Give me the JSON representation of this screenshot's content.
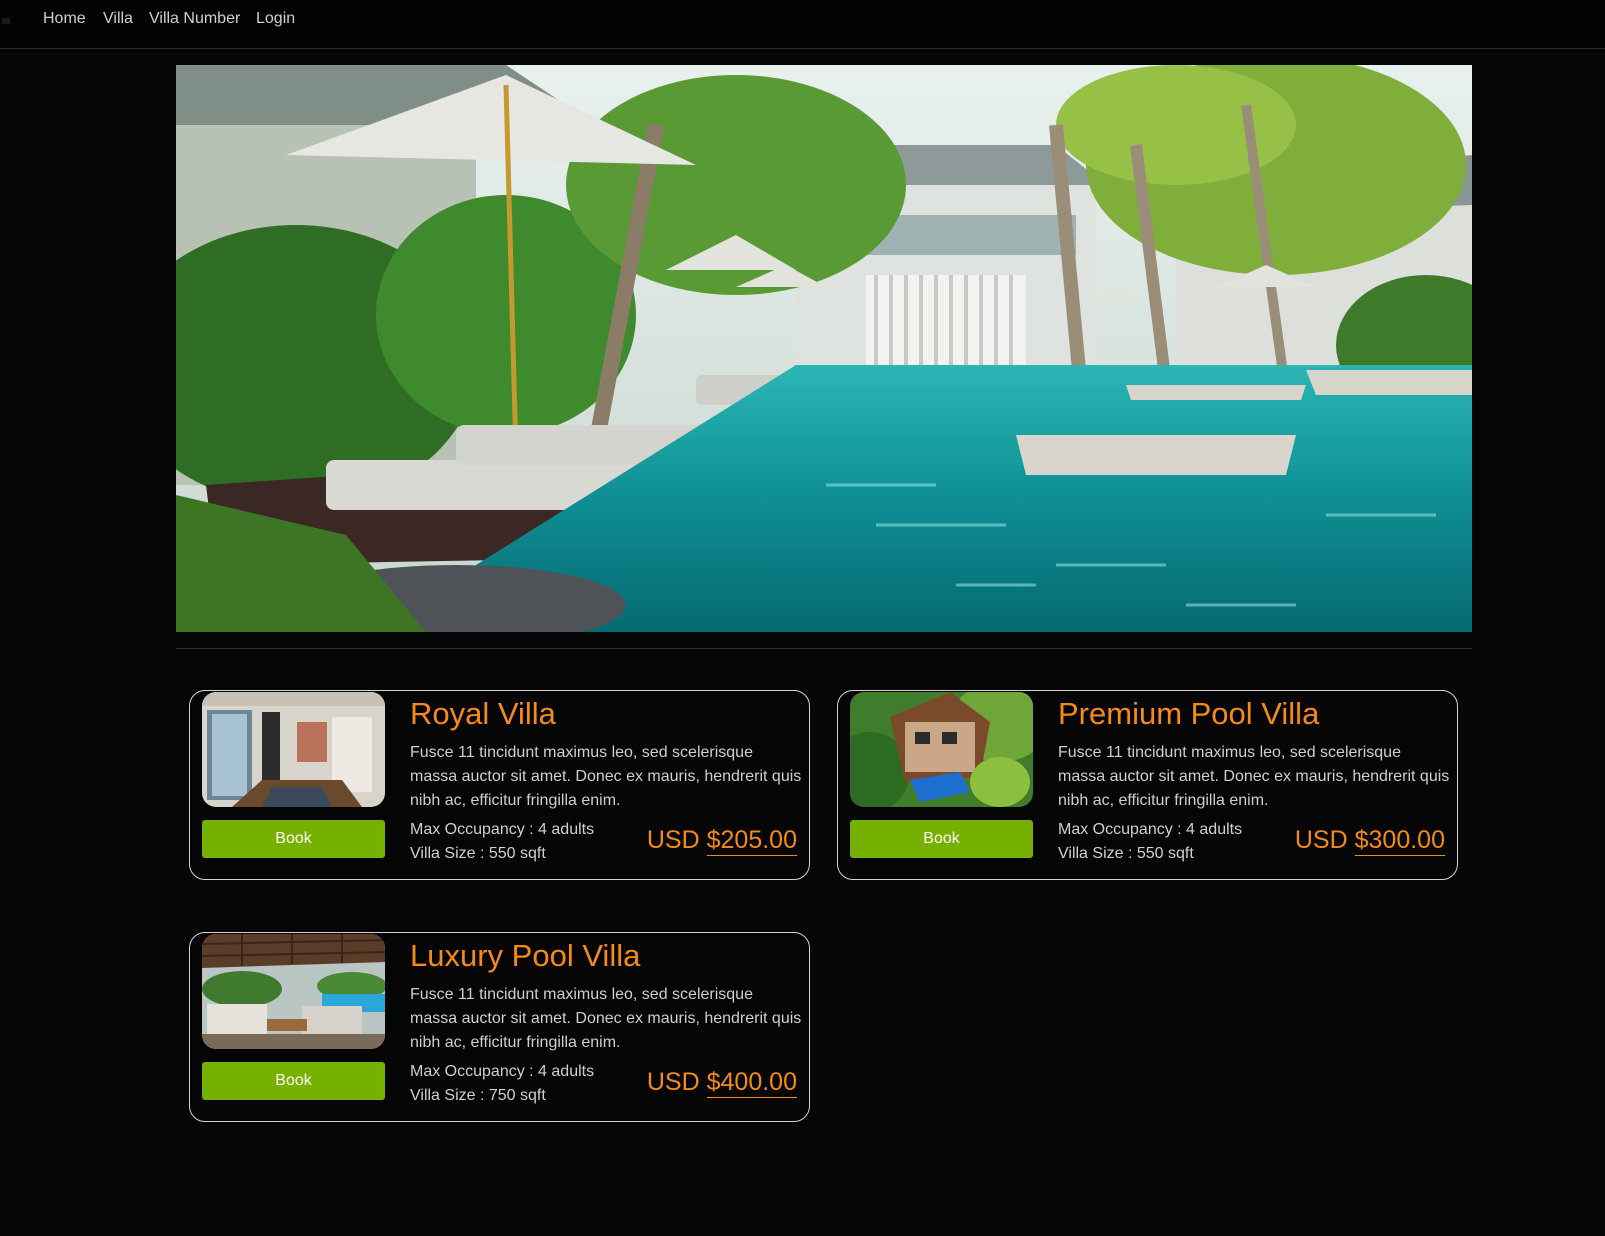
{
  "nav": {
    "items": [
      "Home",
      "Villa",
      "Villa Number",
      "Login"
    ]
  },
  "hero": {
    "icon": "resort-pool-image"
  },
  "villas": [
    {
      "name": "Royal Villa",
      "description": "Fusce 11 tincidunt maximus leo, sed scelerisque massa auctor sit amet. Donec ex mauris, hendrerit quis nibh ac, efficitur fringilla enim.",
      "book_label": "Book",
      "occupancy": "Max Occupancy : 4 adults",
      "size": "Villa Size : 550 sqft",
      "currency": "USD",
      "price": "$205.00"
    },
    {
      "name": "Premium Pool Villa",
      "description": "Fusce 11 tincidunt maximus leo, sed scelerisque massa auctor sit amet. Donec ex mauris, hendrerit quis nibh ac, efficitur fringilla enim.",
      "book_label": "Book",
      "occupancy": "Max Occupancy : 4 adults",
      "size": "Villa Size : 550 sqft",
      "currency": "USD",
      "price": "$300.00"
    },
    {
      "name": "Luxury Pool Villa",
      "description": "Fusce 11 tincidunt maximus leo, sed scelerisque massa auctor sit amet. Donec ex mauris, hendrerit quis nibh ac, efficitur fringilla enim.",
      "book_label": "Book",
      "occupancy": "Max Occupancy : 4 adults",
      "size": "Villa Size : 750 sqft",
      "currency": "USD",
      "price": "$400.00"
    }
  ],
  "colors": {
    "accent": "#f58a14",
    "button": "#76b100",
    "background": "#060606"
  }
}
